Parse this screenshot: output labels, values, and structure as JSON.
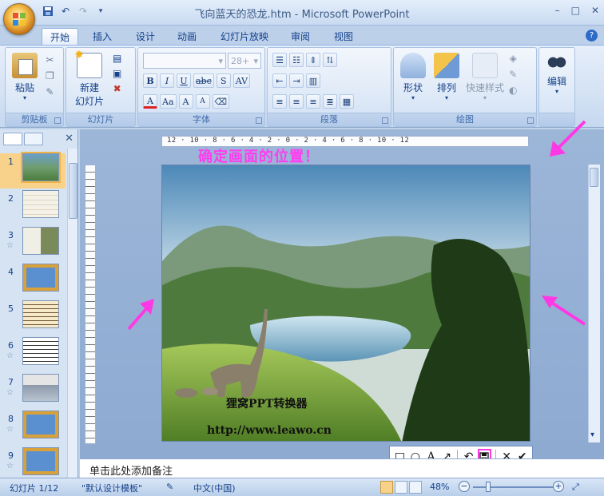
{
  "window": {
    "title": "飞向蓝天的恐龙.htm - Microsoft PowerPoint",
    "controls": [
      "–",
      "□",
      "✕"
    ]
  },
  "ribbon": {
    "tabs": [
      {
        "label": "开始",
        "active": true
      },
      {
        "label": "插入"
      },
      {
        "label": "设计"
      },
      {
        "label": "动画"
      },
      {
        "label": "幻灯片放映"
      },
      {
        "label": "审阅"
      },
      {
        "label": "视图"
      }
    ],
    "groups": {
      "clipboard": {
        "label": "剪贴板",
        "paste_label": "粘贴"
      },
      "slides": {
        "label": "幻灯片",
        "new_slide_label_1": "新建",
        "new_slide_label_2": "幻灯片"
      },
      "font": {
        "label": "字体",
        "font_size": "28+",
        "bold": "B",
        "italic": "I",
        "underline": "U",
        "strike": "abc",
        "shadow": "S",
        "spacing": "AV",
        "font_color": "A",
        "change_case": "Aa",
        "grow": "A",
        "shrink": "A"
      },
      "paragraph": {
        "label": "段落"
      },
      "drawing": {
        "label": "绘图",
        "shapes_label": "形状",
        "arrange_label": "排列",
        "quick_styles_label": "快速样式"
      },
      "editing": {
        "label": "编辑",
        "editing_label": "编辑"
      }
    }
  },
  "slides_pane": {
    "thumbnails": [
      {
        "num": "1",
        "star": false,
        "selected": true
      },
      {
        "num": "2",
        "star": false
      },
      {
        "num": "3",
        "star": true
      },
      {
        "num": "4",
        "star": false
      },
      {
        "num": "5",
        "star": false
      },
      {
        "num": "6",
        "star": true
      },
      {
        "num": "7",
        "star": true
      },
      {
        "num": "8",
        "star": true
      },
      {
        "num": "9",
        "star": true
      }
    ]
  },
  "ruler": {
    "labels": "12 · 10 · 8 · 6 · 4 · 2 · 0 · 2 · 4 · 6 · 8 · 10 · 12"
  },
  "slide": {
    "title": "确定画面的位置！",
    "text_line1": "狸窝PPT转换器",
    "text_line2": "http://www.leawo.cn"
  },
  "capture_toolbar": {
    "rect": "□",
    "ellipse": "○",
    "text": "A",
    "arrow": "↗",
    "undo": "↶",
    "save": "💾",
    "cancel": "✕",
    "confirm": "✔"
  },
  "notes": {
    "placeholder": "单击此处添加备注"
  },
  "statusbar": {
    "slide_info": "幻灯片 1/12",
    "theme": "\"默认设计模板\"",
    "language": "中文(中国)",
    "zoom": "48%"
  },
  "colors": {
    "accent": "#ff38e5",
    "ribbon_text": "#15428b"
  }
}
